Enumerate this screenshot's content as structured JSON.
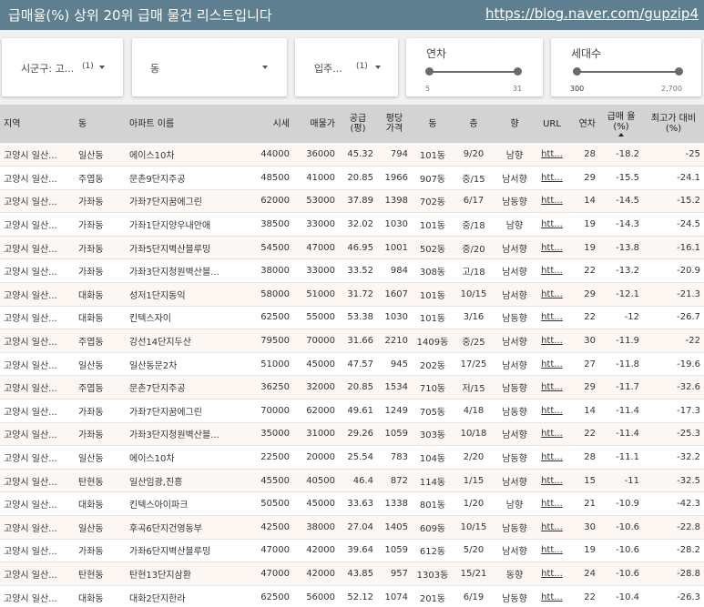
{
  "header": {
    "title": "급매율(%) 상위 20위 급매 물건 리스트입니다",
    "url": "https://blog.naver.com/gupzip4"
  },
  "filters": {
    "sigungu": {
      "label": "시군구: 고...",
      "count": "(1)"
    },
    "dong": {
      "label": "동"
    },
    "ipju": {
      "label": "입주...",
      "count": "(1)"
    },
    "year": {
      "label": "연차",
      "min": "5",
      "max": "31"
    },
    "households": {
      "label": "세대수",
      "min": "300",
      "max": "2,700"
    }
  },
  "table": {
    "columns": [
      "지역",
      "동",
      "아파트 이름",
      "시세",
      "매물가",
      "공급 (평)",
      "평당 가격",
      "동",
      "층",
      "향",
      "URL",
      "연차",
      "급매 율(%)",
      "최고가 대비(%)"
    ],
    "rows": [
      [
        "고양시 일산...",
        "일산동",
        "에이스10차",
        "44000",
        "36000",
        "45.32",
        "794",
        "101동",
        "9/20",
        "남향",
        "htt...",
        "28",
        "-18.2",
        "-25"
      ],
      [
        "고양시 일산...",
        "주엽동",
        "문촌9단지주공",
        "48500",
        "41000",
        "20.85",
        "1966",
        "907동",
        "중/15",
        "남서향",
        "htt...",
        "29",
        "-15.5",
        "-24.1"
      ],
      [
        "고양시 일산...",
        "가좌동",
        "가좌7단지꿈에그린",
        "62000",
        "53000",
        "37.89",
        "1398",
        "702동",
        "6/17",
        "남동향",
        "htt...",
        "14",
        "-14.5",
        "-15.2"
      ],
      [
        "고양시 일산...",
        "가좌동",
        "가좌1단지양우내안애",
        "38500",
        "33000",
        "32.02",
        "1030",
        "101동",
        "중/18",
        "남향",
        "htt...",
        "19",
        "-14.3",
        "-24.5"
      ],
      [
        "고양시 일산...",
        "가좌동",
        "가좌5단지벽산블루밍",
        "54500",
        "47000",
        "46.95",
        "1001",
        "502동",
        "중/20",
        "남서향",
        "htt...",
        "19",
        "-13.8",
        "-16.1"
      ],
      [
        "고양시 일산...",
        "가좌동",
        "가좌3단지청원벽산블...",
        "38000",
        "33000",
        "33.52",
        "984",
        "308동",
        "고/18",
        "남서향",
        "htt...",
        "22",
        "-13.2",
        "-20.9"
      ],
      [
        "고양시 일산...",
        "대화동",
        "성저1단지동익",
        "58000",
        "51000",
        "31.72",
        "1607",
        "101동",
        "10/15",
        "남서향",
        "htt...",
        "29",
        "-12.1",
        "-21.3"
      ],
      [
        "고양시 일산...",
        "대화동",
        "킨텍스자이",
        "62500",
        "55000",
        "53.38",
        "1030",
        "101동",
        "3/16",
        "남동향",
        "htt...",
        "22",
        "-12",
        "-26.7"
      ],
      [
        "고양시 일산...",
        "주엽동",
        "강선14단지두산",
        "79500",
        "70000",
        "31.66",
        "2210",
        "1409동",
        "중/25",
        "남서향",
        "htt...",
        "30",
        "-11.9",
        "-22"
      ],
      [
        "고양시 일산...",
        "일산동",
        "일산동문2차",
        "51000",
        "45000",
        "47.57",
        "945",
        "202동",
        "17/25",
        "남서향",
        "htt...",
        "27",
        "-11.8",
        "-19.6"
      ],
      [
        "고양시 일산...",
        "주엽동",
        "문촌7단지주공",
        "36250",
        "32000",
        "20.85",
        "1534",
        "710동",
        "저/15",
        "남동향",
        "htt...",
        "29",
        "-11.7",
        "-32.6"
      ],
      [
        "고양시 일산...",
        "가좌동",
        "가좌7단지꿈에그린",
        "70000",
        "62000",
        "49.61",
        "1249",
        "705동",
        "4/18",
        "남동향",
        "htt...",
        "14",
        "-11.4",
        "-17.3"
      ],
      [
        "고양시 일산...",
        "가좌동",
        "가좌3단지청원벽산블...",
        "35000",
        "31000",
        "29.26",
        "1059",
        "303동",
        "10/18",
        "남서향",
        "htt...",
        "22",
        "-11.4",
        "-25.3"
      ],
      [
        "고양시 일산...",
        "일산동",
        "에이스10차",
        "22500",
        "20000",
        "25.54",
        "783",
        "104동",
        "2/20",
        "남동향",
        "htt...",
        "28",
        "-11.1",
        "-32.2"
      ],
      [
        "고양시 일산...",
        "탄현동",
        "일산임광,진흥",
        "45500",
        "40500",
        "46.4",
        "872",
        "114동",
        "1/15",
        "남서향",
        "htt...",
        "15",
        "-11",
        "-32.5"
      ],
      [
        "고양시 일산...",
        "대화동",
        "킨텍스아이파크",
        "50500",
        "45000",
        "33.63",
        "1338",
        "801동",
        "1/20",
        "남향",
        "htt...",
        "21",
        "-10.9",
        "-42.3"
      ],
      [
        "고양시 일산...",
        "일산동",
        "후곡6단지건영동부",
        "42500",
        "38000",
        "27.04",
        "1405",
        "609동",
        "10/15",
        "남동향",
        "htt...",
        "30",
        "-10.6",
        "-22.8"
      ],
      [
        "고양시 일산...",
        "가좌동",
        "가좌6단지벽산블루밍",
        "47000",
        "42000",
        "39.64",
        "1059",
        "612동",
        "5/20",
        "남서향",
        "htt...",
        "19",
        "-10.6",
        "-28.2"
      ],
      [
        "고양시 일산...",
        "탄현동",
        "탄현13단지삼환",
        "47000",
        "42000",
        "43.85",
        "957",
        "1303동",
        "15/21",
        "동향",
        "htt...",
        "24",
        "-10.6",
        "-28.8"
      ],
      [
        "고양시 일산...",
        "대화동",
        "대화2단지한라",
        "62500",
        "56000",
        "52.12",
        "1074",
        "201동",
        "6/19",
        "남동향",
        "htt...",
        "22",
        "-10.4",
        "-26.3"
      ]
    ]
  }
}
